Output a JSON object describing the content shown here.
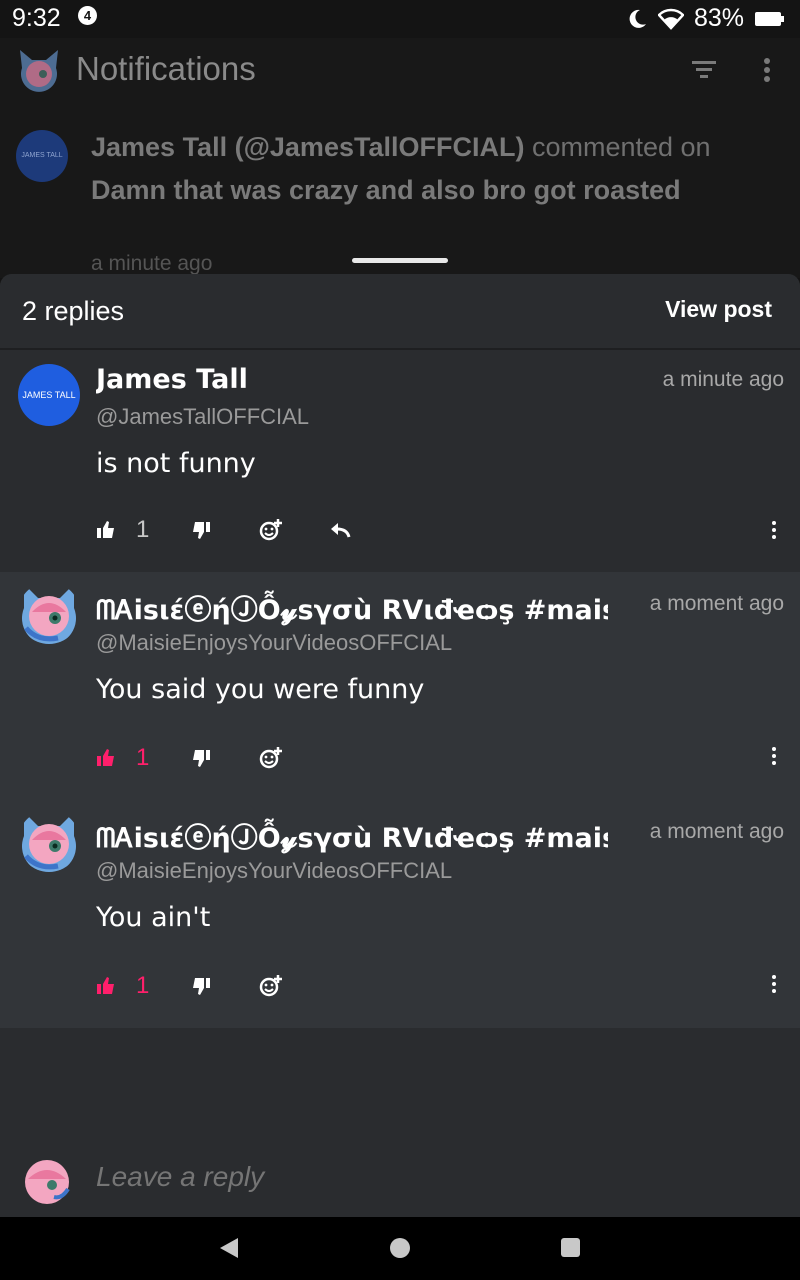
{
  "status_bar": {
    "time": "9:32",
    "notif_count": "4",
    "battery": "83%"
  },
  "app": {
    "title": "Notifications"
  },
  "notification": {
    "avatar_text": "JAMES TALL",
    "author": "James Tall (@JamesTallOFFCIAL)",
    "verb": " commented on ",
    "post": "Damn that was crazy and also bro got roasted",
    "time": "a minute ago"
  },
  "sheet": {
    "replies_count": "2 replies",
    "view_post": "View post"
  },
  "comments": [
    {
      "avatar_text": "JAMES TALL",
      "name": "James Tall",
      "handle": "@JamesTallOFFCIAL",
      "time": "a minute ago",
      "body": "is not funny",
      "likes": "1"
    },
    {
      "name": "ᗰᎪisιέⓔήⒿỖ𝔂ѕγσù RⅤιđҽѻş #maisp",
      "handle": "@MaisieEnjoysYourVideosOFFCIAL",
      "time": "a moment ago",
      "body": "You said you were funny",
      "likes": "1"
    },
    {
      "name": "ᗰᎪisιέⓔήⒿỖ𝔂ѕγσù RⅤιđҽѻş #maisp",
      "handle": "@MaisieEnjoysYourVideosOFFCIAL",
      "time": "a moment ago",
      "body": "You ain't",
      "likes": "1"
    }
  ],
  "reply_bar": {
    "placeholder": "Leave a reply"
  },
  "colors": {
    "liked": "#ff1f6b",
    "sheet": "#2a2c2f",
    "highlight": "#323539"
  }
}
